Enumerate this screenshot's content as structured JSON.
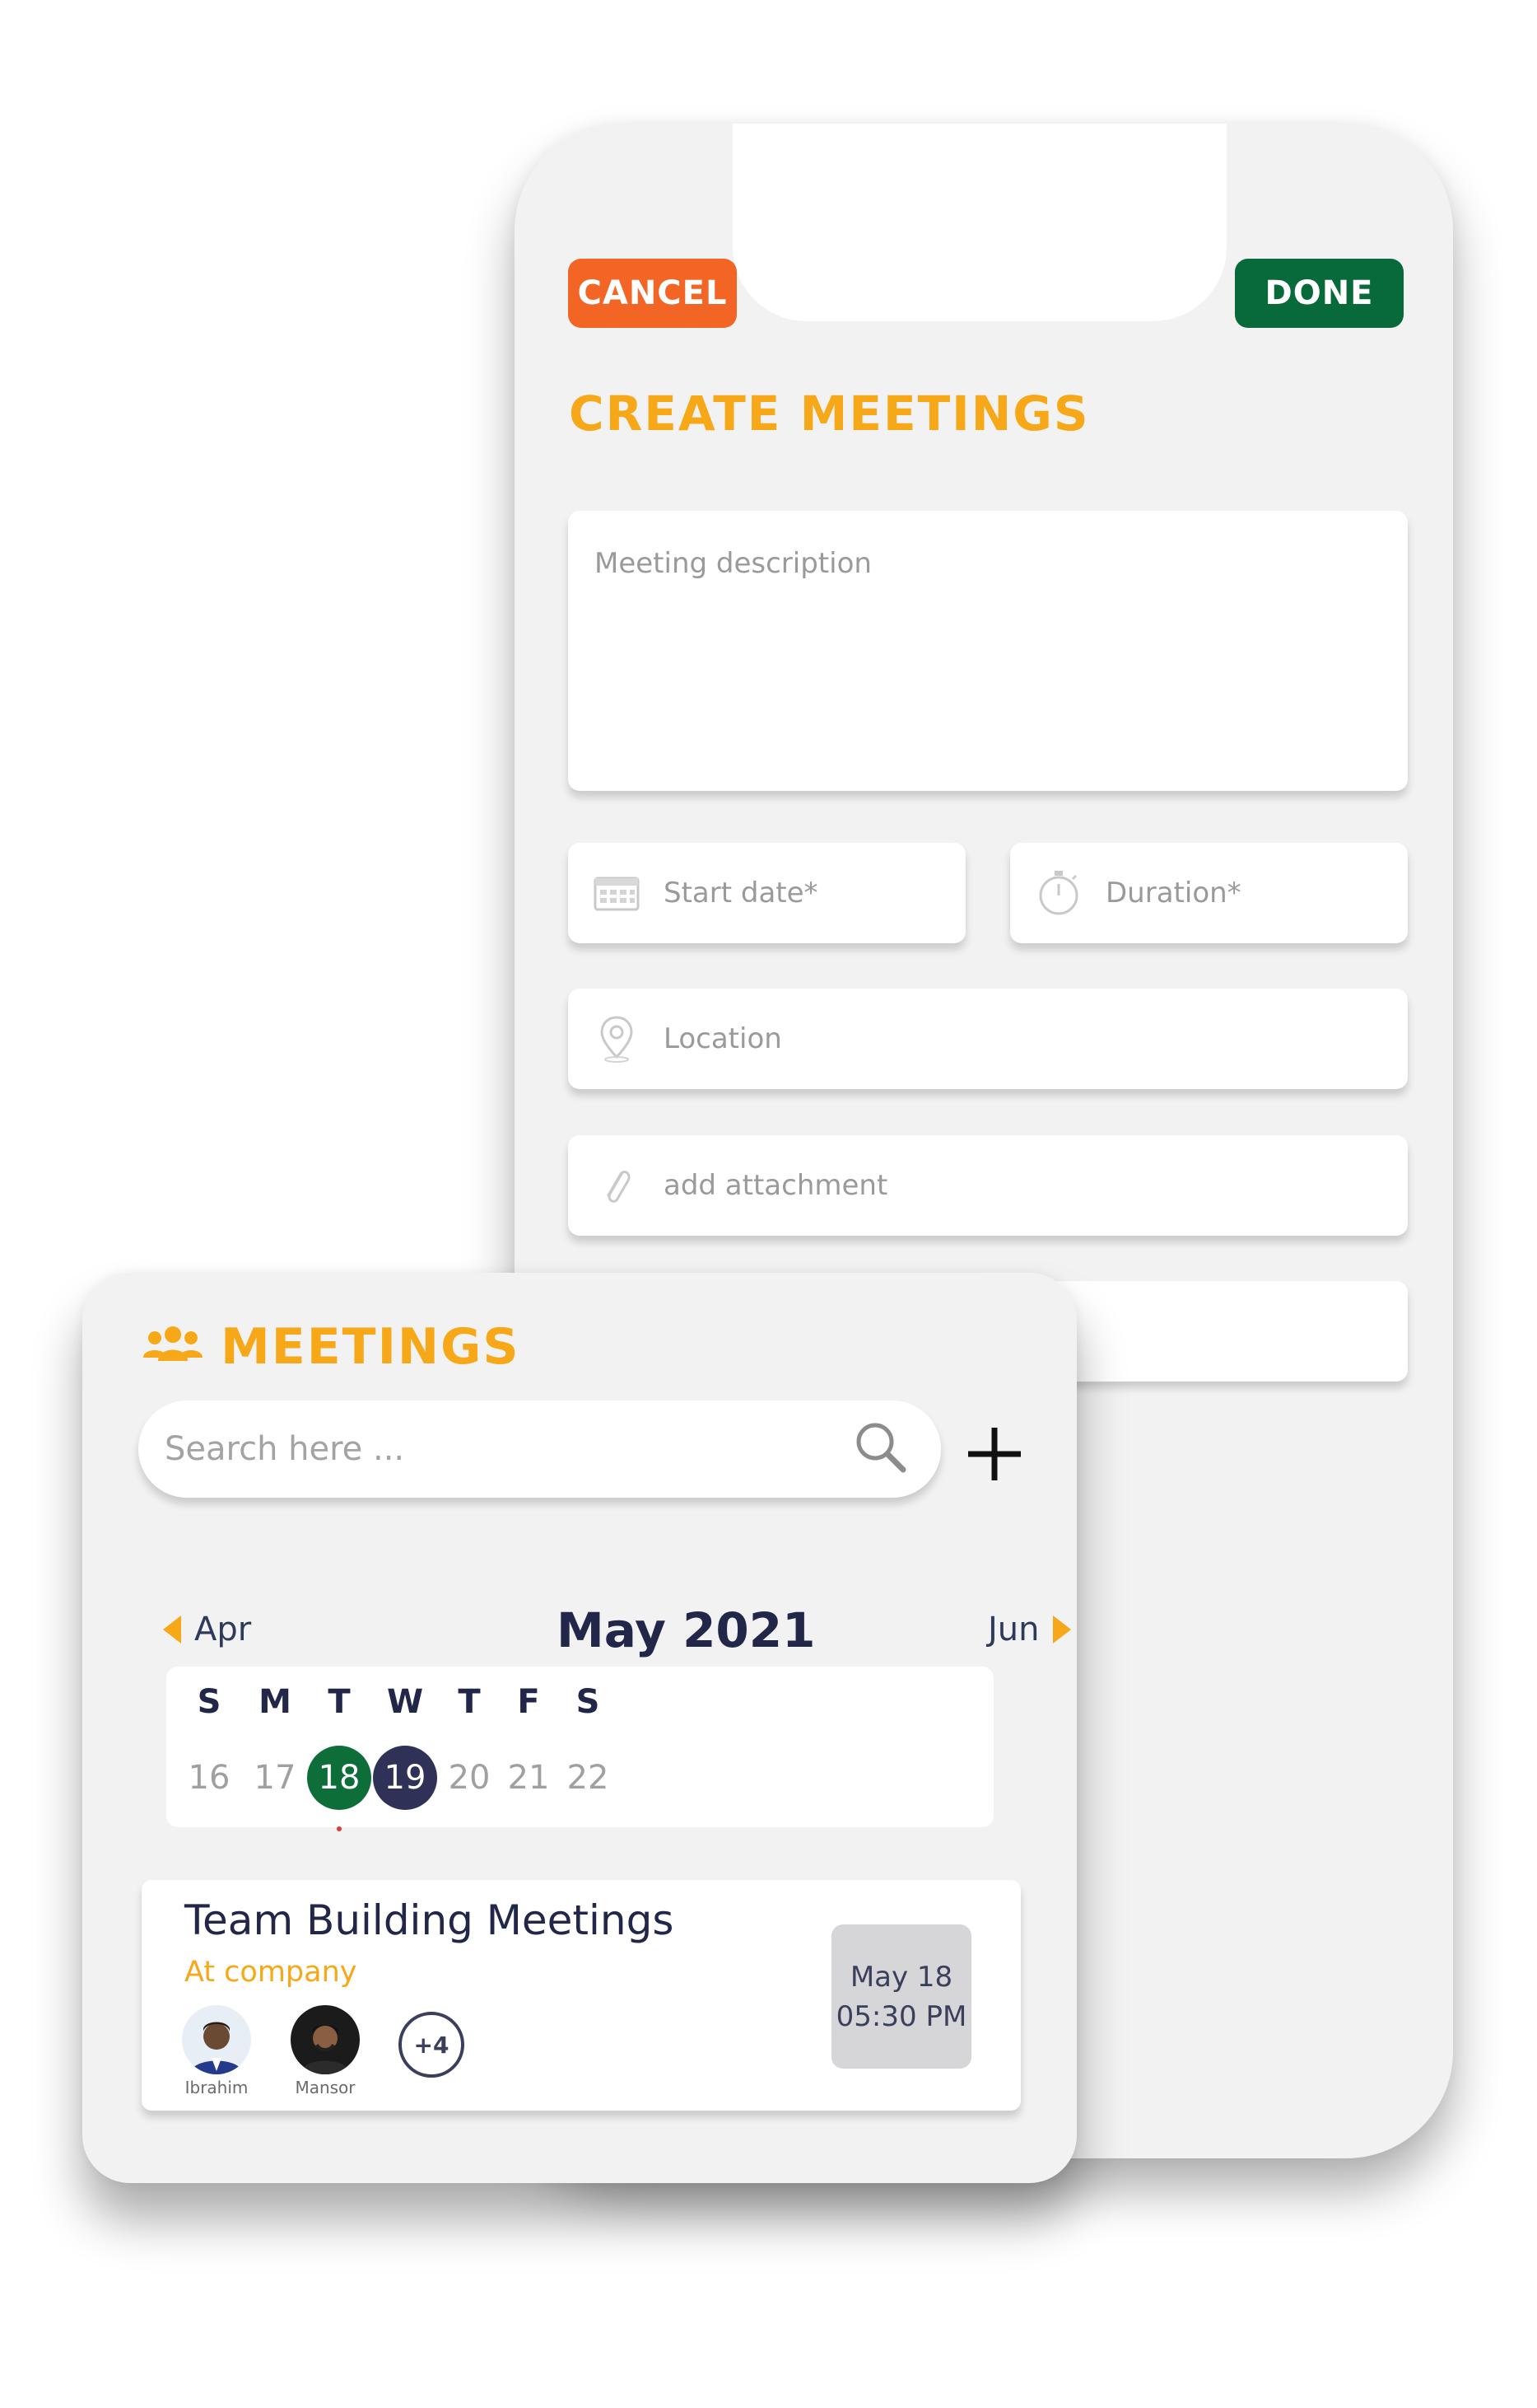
{
  "create": {
    "cancel_label": "CANCEL",
    "done_label": "DONE",
    "title": "CREATE MEETINGS",
    "description_placeholder": "Meeting description",
    "start_date_placeholder": "Start date*",
    "duration_placeholder": "Duration*",
    "location_placeholder": "Location",
    "attachment_placeholder": "add attachment",
    "colors": {
      "cancel": "#f26524",
      "done": "#086a3a",
      "accent": "#f6a818"
    }
  },
  "meetings": {
    "title": "MEETINGS",
    "title_icon": "people-group-icon",
    "search_placeholder": "Search here ...",
    "search_icon": "search-icon",
    "add_icon": "plus-icon",
    "calendar": {
      "prev_month": "Apr",
      "current_month": "May 2021",
      "next_month": "Jun",
      "weekdays": [
        "S",
        "M",
        "T",
        "W",
        "T",
        "F",
        "S"
      ],
      "days": [
        "16",
        "17",
        "18",
        "19",
        "20",
        "21",
        "22"
      ],
      "today": "18",
      "selected": "19",
      "today_color": "#0d6e3a",
      "selected_color": "#2f3156"
    },
    "event": {
      "title": "Team Building Meetings",
      "subtitle": "At company",
      "attendees": [
        "Ibrahim",
        "Mansor"
      ],
      "more": "+4",
      "date": "May 18",
      "time": "05:30 PM"
    }
  }
}
